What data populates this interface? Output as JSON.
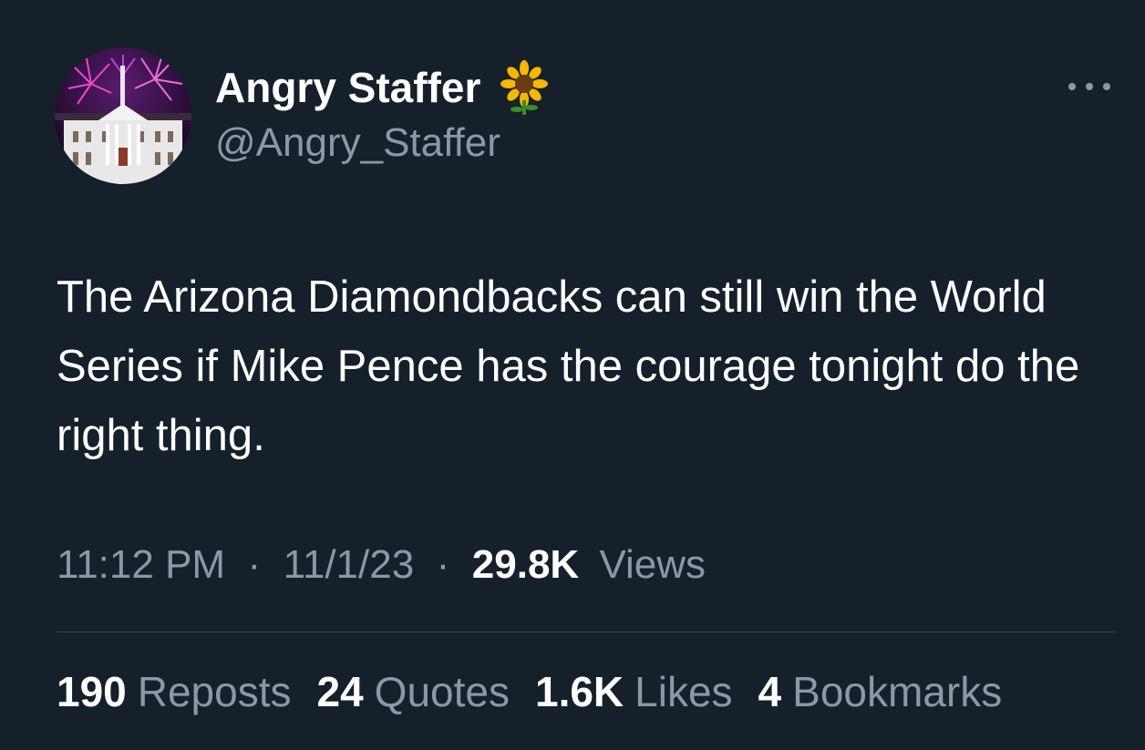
{
  "author": {
    "display_name": "Angry Staffer",
    "verified_emoji_icon": "sunflower-icon",
    "handle": "@Angry_Staffer",
    "avatar_icon": "white-house-fireworks-avatar"
  },
  "tweet": {
    "text": "The Arizona Diamondbacks can still win the World Series if Mike Pence has the courage tonight do the right thing.",
    "time": "11:12 PM",
    "date": "11/1/23",
    "separator": "·",
    "views_count": "29.8K",
    "views_label": "Views"
  },
  "stats": [
    {
      "count": "190",
      "label": "Reposts"
    },
    {
      "count": "24",
      "label": "Quotes"
    },
    {
      "count": "1.6K",
      "label": "Likes"
    },
    {
      "count": "4",
      "label": "Bookmarks"
    }
  ],
  "colors": {
    "background": "#15202b",
    "text": "#ffffff",
    "secondary_text": "#8b98a5",
    "divider": "#38444d"
  },
  "more_icon": "more-horizontal-icon"
}
